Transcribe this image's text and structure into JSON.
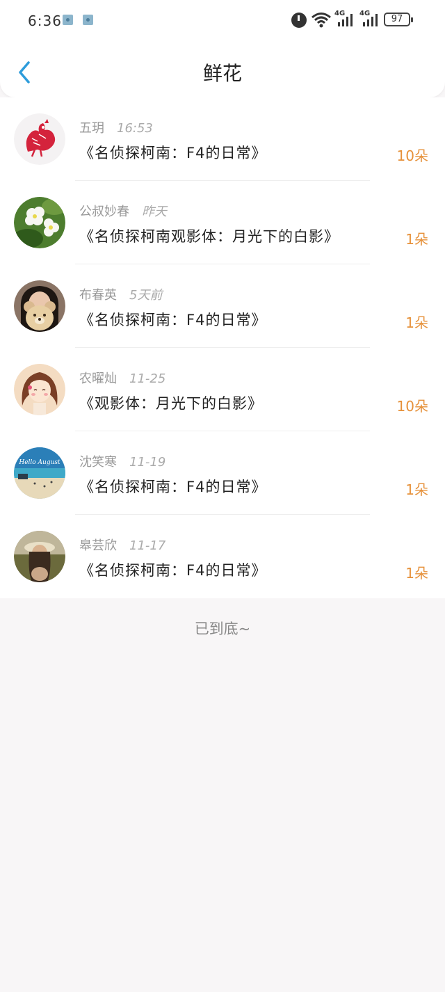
{
  "status_bar": {
    "time": "6:36",
    "net_labels": [
      "4G",
      "4G"
    ],
    "battery": "97"
  },
  "header": {
    "title": "鲜花"
  },
  "items": [
    {
      "name": "五玥",
      "when": "16:53",
      "work": "《名侦探柯南：F4的日常》",
      "count": "10朵"
    },
    {
      "name": "公叔妙春",
      "when": "昨天",
      "work": "《名侦探柯南观影体：月光下的白影》",
      "count": "1朵"
    },
    {
      "name": "布春英",
      "when": "5天前",
      "work": "《名侦探柯南：F4的日常》",
      "count": "1朵"
    },
    {
      "name": "农曜灿",
      "when": "11-25",
      "work": "《观影体：月光下的白影》",
      "count": "10朵"
    },
    {
      "name": "沈笑寒",
      "when": "11-19",
      "work": "《名侦探柯南：F4的日常》",
      "count": "1朵"
    },
    {
      "name": "皋芸欣",
      "when": "11-17",
      "work": "《名侦探柯南：F4的日常》",
      "count": "1朵"
    }
  ],
  "avatar4_caption": "Hello August",
  "footer": "已到底~",
  "colors": {
    "accent": "#2d9cdb",
    "count": "#e6913a"
  }
}
